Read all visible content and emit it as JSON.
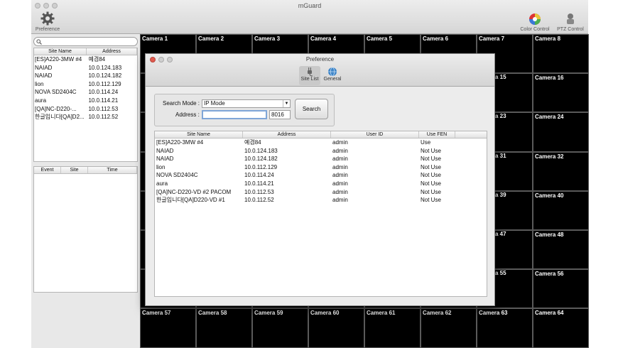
{
  "app": {
    "title": "mGuard"
  },
  "toolbar": {
    "preference_label": "Preference",
    "color_control_label": "Color Control",
    "ptz_control_label": "PTZ Control"
  },
  "sidebar": {
    "search_placeholder": "",
    "site_headers": [
      "Site Name",
      "Address"
    ],
    "sites": [
      {
        "name": "[ES]A220-3MW #4",
        "address": "예겸84"
      },
      {
        "name": "NAIAD",
        "address": "10.0.124.183"
      },
      {
        "name": "NAIAD",
        "address": "10.0.124.182"
      },
      {
        "name": "lion",
        "address": "10.0.112.129"
      },
      {
        "name": "NOVA SD2404C",
        "address": "10.0.114.24"
      },
      {
        "name": "aura",
        "address": "10.0.114.21"
      },
      {
        "name": "[QA]NC-D220-...",
        "address": "10.0.112.53"
      },
      {
        "name": "한글입니다[QA]D2...",
        "address": "10.0.112.52"
      }
    ],
    "event_headers": [
      "Event",
      "Site",
      "Time"
    ]
  },
  "cameras": {
    "top_row": [
      "Camera 1",
      "Camera 2",
      "Camera 3",
      "Camera 4",
      "Camera 5",
      "Camera 6",
      "Camera 7",
      "Camera 8"
    ],
    "right_col": [
      "Camera 16",
      "Camera 24",
      "Camera 32",
      "Camera 40",
      "Camera 48",
      "Camera 56"
    ],
    "partial_col": [
      "a 15",
      "a 23",
      "a 31",
      "a 39",
      "a 47",
      "a 55"
    ],
    "bottom_row": [
      "Camera 57",
      "Camera 58",
      "Camera 59",
      "Camera 60",
      "Camera 61",
      "Camera 62",
      "Camera 63",
      "Camera 64"
    ]
  },
  "dialog": {
    "title": "Preference",
    "tabs": [
      "Site List",
      "General"
    ],
    "search_mode_label": "Search Mode :",
    "search_mode_value": "IP Mode",
    "address_label": "Address :",
    "address_value": "",
    "port_value": "8016",
    "search_button": "Search",
    "list_headers": [
      "Site Name",
      "Address",
      "User ID",
      "Use FEN"
    ],
    "rows": [
      {
        "name": "[ES]A220-3MW #4",
        "address": "예겸84",
        "user": "admin",
        "fen": "Use"
      },
      {
        "name": "NAIAD",
        "address": "10.0.124.183",
        "user": "admin",
        "fen": "Not Use"
      },
      {
        "name": "NAIAD",
        "address": "10.0.124.182",
        "user": "admin",
        "fen": "Not Use"
      },
      {
        "name": "lion",
        "address": "10.0.112.129",
        "user": "admin",
        "fen": "Not Use"
      },
      {
        "name": "NOVA SD2404C",
        "address": "10.0.114.24",
        "user": "admin",
        "fen": "Not Use"
      },
      {
        "name": "aura",
        "address": "10.0.114.21",
        "user": "admin",
        "fen": "Not Use"
      },
      {
        "name": "[QA]NC-D220-VD #2 PACOM",
        "address": "10.0.112.53",
        "user": "admin",
        "fen": "Not Use"
      },
      {
        "name": "한글입니다[QA]D220-VD #1",
        "address": "10.0.112.52",
        "user": "admin",
        "fen": "Not Use"
      }
    ]
  },
  "colors": {
    "grid_bg": "#000000",
    "camera_label": "#ffffff",
    "close_button": "#e05a4e",
    "focus_ring": "#7fa6d8"
  }
}
